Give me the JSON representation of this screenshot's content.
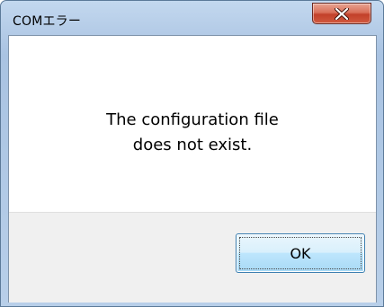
{
  "window": {
    "title": "COMエラー",
    "close_icon": "close-x-icon"
  },
  "message": {
    "line1": "The configuration file",
    "line2": "does not exist."
  },
  "buttons": {
    "ok_label": "OK"
  },
  "colors": {
    "close_button": "#c94a33",
    "title_bar": "#b6cde8",
    "ok_button_border": "#3c7fb1"
  }
}
